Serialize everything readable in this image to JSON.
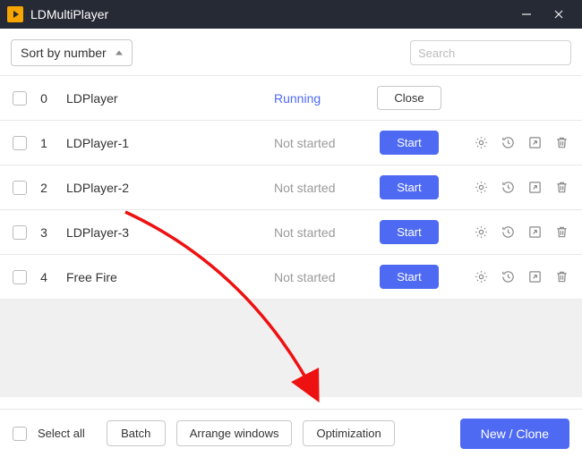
{
  "window": {
    "title": "LDMultiPlayer"
  },
  "toolbar": {
    "sort": "Sort by number",
    "search_placeholder": "Search"
  },
  "statuses": {
    "running": "Running",
    "not_started": "Not started"
  },
  "buttons": {
    "close": "Close",
    "start": "Start"
  },
  "rows": [
    {
      "index": "0",
      "name": "LDPlayer",
      "status": "Running",
      "button": "Close",
      "primary": false,
      "icons": false
    },
    {
      "index": "1",
      "name": "LDPlayer-1",
      "status": "Not started",
      "button": "Start",
      "primary": true,
      "icons": true
    },
    {
      "index": "2",
      "name": "LDPlayer-2",
      "status": "Not started",
      "button": "Start",
      "primary": true,
      "icons": true
    },
    {
      "index": "3",
      "name": "LDPlayer-3",
      "status": "Not started",
      "button": "Start",
      "primary": true,
      "icons": true
    },
    {
      "index": "4",
      "name": "Free Fire",
      "status": "Not started",
      "button": "Start",
      "primary": true,
      "icons": true
    }
  ],
  "footer": {
    "select_all": "Select all",
    "batch": "Batch",
    "arrange": "Arrange windows",
    "optimization": "Optimization",
    "new_clone": "New / Clone"
  }
}
